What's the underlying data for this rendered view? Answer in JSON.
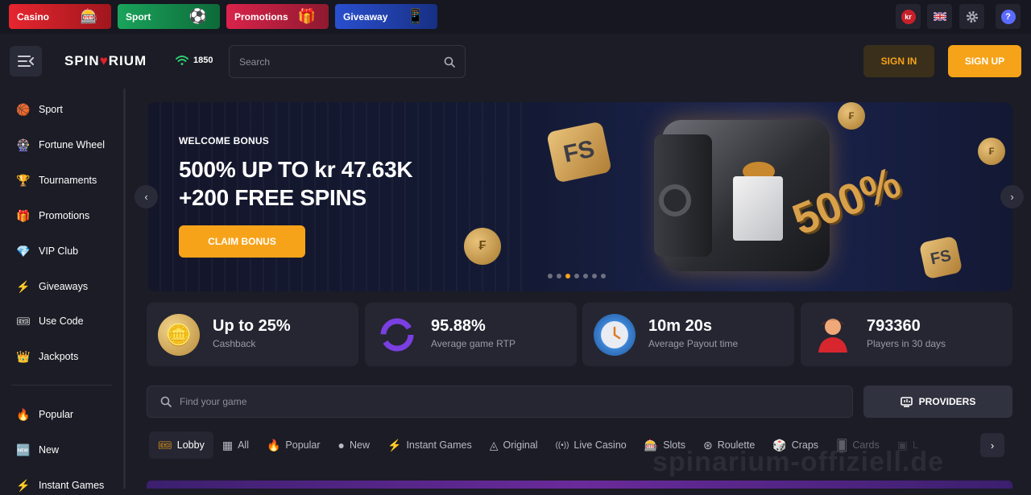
{
  "top_tabs": [
    {
      "label": "Casino",
      "art_icon": "slot-machine-icon"
    },
    {
      "label": "Sport",
      "art_icon": "soccer-ball-icon"
    },
    {
      "label": "Promotions",
      "art_icon": "gift-icon"
    },
    {
      "label": "Giveaway",
      "art_icon": "phone-icon"
    }
  ],
  "top_icons": {
    "currency": "kr",
    "language_flag": "uk-flag-icon",
    "settings": "gear-icon",
    "help": "help-icon"
  },
  "header": {
    "logo": {
      "prefix": "SPIN",
      "mark": "♥",
      "suffix": "RIUM"
    },
    "online_count": "1850",
    "search_placeholder": "Search",
    "sign_in": "SIGN IN",
    "sign_up": "SIGN UP"
  },
  "sidebar": {
    "items": [
      {
        "label": "Sport",
        "icon": "🏀"
      },
      {
        "label": "Fortune Wheel",
        "icon": "🎡"
      },
      {
        "label": "Tournaments",
        "icon": "🏆"
      },
      {
        "label": "Promotions",
        "icon": "🎁"
      },
      {
        "label": "VIP Club",
        "icon": "💎"
      },
      {
        "label": "Giveaways",
        "icon": "⚡"
      },
      {
        "label": "Use Code",
        "icon": "🎟"
      },
      {
        "label": "Jackpots",
        "icon": "👑"
      }
    ],
    "secondary_items": [
      {
        "label": "Popular",
        "icon": "🔥"
      },
      {
        "label": "New",
        "icon": "🆕"
      },
      {
        "label": "Instant Games",
        "icon": "⚡"
      }
    ]
  },
  "banner": {
    "eyebrow": "WELCOME BONUS",
    "line1": "500% UP TO kr 47.63K",
    "line2": "+200 FREE SPINS",
    "cta": "CLAIM BONUS",
    "art_text": "500%",
    "tile_text": "FS",
    "dots_total": 7,
    "active_dot": 2
  },
  "stats": [
    {
      "value": "Up to 25%",
      "label": "Cashback",
      "icon": "coins-icon"
    },
    {
      "value": "95.88%",
      "label": "Average game RTP",
      "icon": "refresh-icon"
    },
    {
      "value": "10m 20s",
      "label": "Average Payout time",
      "icon": "clock-icon"
    },
    {
      "value": "793360",
      "label": "Players in 30 days",
      "icon": "player-icon"
    }
  ],
  "game_search": {
    "placeholder": "Find your game",
    "providers_label": "PROVIDERS"
  },
  "categories": [
    {
      "label": "Lobby",
      "icon": "🎟"
    },
    {
      "label": "All",
      "icon": "▦"
    },
    {
      "label": "Popular",
      "icon": "🔥"
    },
    {
      "label": "New",
      "icon": "●"
    },
    {
      "label": "Instant Games",
      "icon": "⚡"
    },
    {
      "label": "Original",
      "icon": "◬"
    },
    {
      "label": "Live Casino",
      "icon": "((•))"
    },
    {
      "label": "Slots",
      "icon": "🎰"
    },
    {
      "label": "Roulette",
      "icon": "⊛"
    },
    {
      "label": "Craps",
      "icon": "🎲"
    },
    {
      "label": "Cards",
      "icon": "🂠"
    },
    {
      "label": "L",
      "icon": "▣"
    }
  ],
  "watermark": "spinarium-offiziell.de"
}
